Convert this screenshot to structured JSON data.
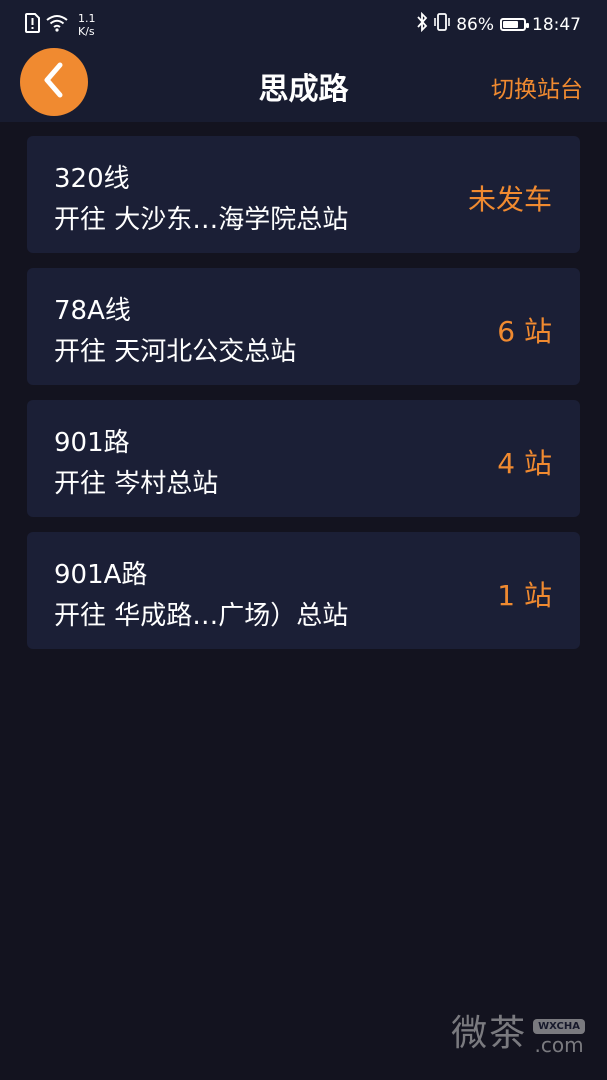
{
  "status_bar": {
    "net_speed_value": "1.1",
    "net_speed_unit": "K/s",
    "battery_percent": "86%",
    "battery_level": 0.86,
    "time": "18:47"
  },
  "header": {
    "title": "思成路",
    "switch_label": "切换站台"
  },
  "routes": [
    {
      "name": "320线",
      "destination": "开往 大沙东…海学院总站",
      "status": "未发车"
    },
    {
      "name": "78A线",
      "destination": "开往 天河北公交总站",
      "status": "6 站"
    },
    {
      "name": "901路",
      "destination": "开往 岑村总站",
      "status": "4 站"
    },
    {
      "name": "901A路",
      "destination": "开往 华成路…广场）总站",
      "status": "1 站"
    }
  ],
  "watermark": {
    "main": "微茶",
    "badge": "WXCHA",
    "suffix": ".com"
  },
  "colors": {
    "accent": "#f08a30",
    "background": "#13131f",
    "card": "#1b1f36",
    "bar": "#181c30"
  }
}
